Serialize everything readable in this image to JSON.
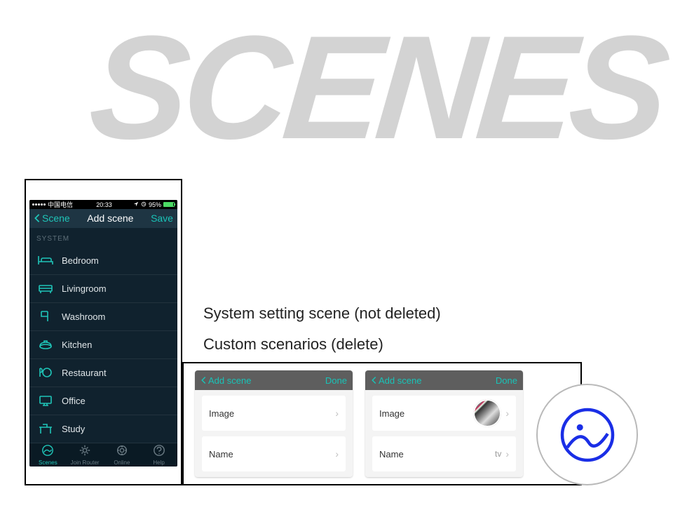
{
  "banner_title": "SCENES",
  "phone": {
    "statusbar": {
      "carrier": "中国电信",
      "time": "20:33",
      "battery_pct": "95%"
    },
    "nav": {
      "back_label": "Scene",
      "title": "Add scene",
      "save_label": "Save"
    },
    "section_header": "SYSTEM",
    "scenes": [
      {
        "label": "Bedroom",
        "icon": "bed"
      },
      {
        "label": "Livingroom",
        "icon": "sofa"
      },
      {
        "label": "Washroom",
        "icon": "towel"
      },
      {
        "label": "Kitchen",
        "icon": "pot"
      },
      {
        "label": "Restaurant",
        "icon": "dining"
      },
      {
        "label": "Office",
        "icon": "monitor"
      },
      {
        "label": "Study",
        "icon": "desk"
      }
    ],
    "tabs": [
      {
        "label": "Scenes",
        "icon": "scenes",
        "active": true
      },
      {
        "label": "Join Router",
        "icon": "router",
        "active": false
      },
      {
        "label": "Online",
        "icon": "online",
        "active": false
      },
      {
        "label": "Help",
        "icon": "help",
        "active": false
      }
    ]
  },
  "annotations": {
    "line1": "System setting scene (not deleted)",
    "line2": "Custom scenarios (delete)"
  },
  "mini_panels": [
    {
      "back_label": "Add scene",
      "done_label": "Done",
      "rows": [
        {
          "label": "Image",
          "has_thumb": false,
          "value": ""
        },
        {
          "label": "Name",
          "has_thumb": false,
          "value": ""
        }
      ]
    },
    {
      "back_label": "Add scene",
      "done_label": "Done",
      "rows": [
        {
          "label": "Image",
          "has_thumb": true,
          "value": ""
        },
        {
          "label": "Name",
          "has_thumb": false,
          "value": "tv"
        }
      ]
    }
  ],
  "colors": {
    "accent": "#1fc5b8",
    "phone_bg": "#10222e",
    "watermark_stroke": "#1a2ee6"
  }
}
